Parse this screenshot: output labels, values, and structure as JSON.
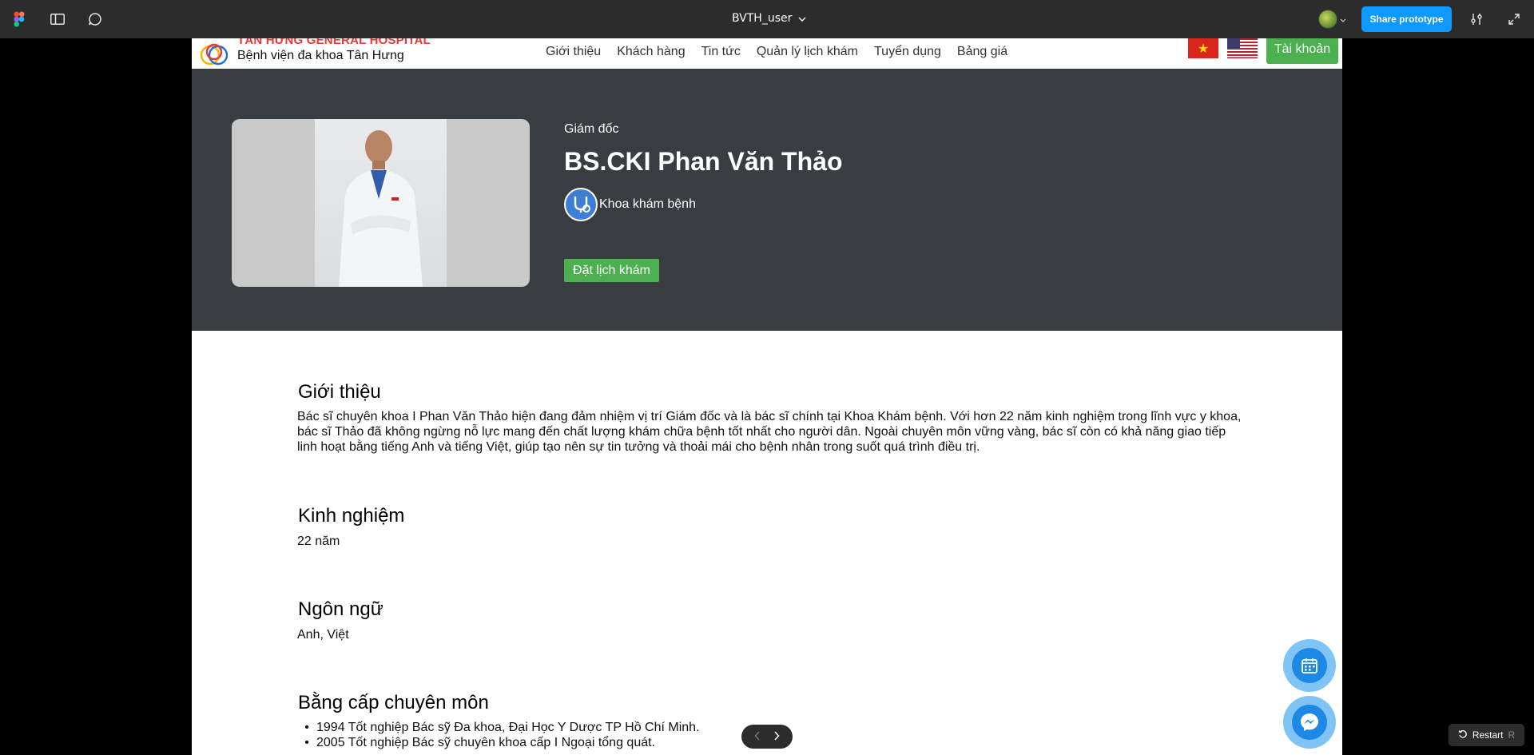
{
  "figma": {
    "file_title": "BVTH_user",
    "share_label": "Share prototype",
    "restart_label": "Restart",
    "restart_key": "R"
  },
  "site": {
    "logo_top": "TÂN HƯNG GENERAL HOSPITAL",
    "logo_bottom": "Bệnh viện đa khoa Tân Hưng",
    "nav": [
      "Giới thiệu",
      "Khách hàng",
      "Tin tức",
      "Quản lý lịch khám",
      "Tuyển dụng",
      "Bảng giá"
    ],
    "flag_vn_star": "★",
    "account_label": "Tài khoản"
  },
  "doctor": {
    "role": "Giám đốc",
    "name": "BS.CKI Phan Văn Thảo",
    "department": "Khoa khám bệnh",
    "book_label": "Đặt lịch khám"
  },
  "sections": {
    "intro_title": "Giới thiệu",
    "intro_body": "Bác sĩ chuyên khoa I Phan Văn Thảo hiện đang đảm nhiệm vị trí Giám đốc và là bác sĩ chính tại Khoa Khám bệnh. Với hơn 22 năm kinh nghiệm trong lĩnh vực y khoa, bác sĩ Thảo đã không ngừng nỗ lực mang đến chất lượng khám chữa bệnh tốt nhất cho người dân. Ngoài chuyên môn vững vàng, bác sĩ còn có khả năng giao tiếp linh hoạt bằng tiếng Anh và tiếng Việt, giúp tạo nên sự tin tưởng và thoải mái cho bệnh nhân trong suốt quá trình điều trị.",
    "experience_title": "Kinh nghiệm",
    "experience_value": "22 năm",
    "language_title": "Ngôn ngữ",
    "language_value": "Anh, Việt",
    "certs_title": "Bằng cấp chuyên môn",
    "certs": [
      "1994 Tốt nghiệp Bác sỹ Đa khoa, Đại Học Y Dược TP Hồ Chí Minh.",
      "2005 Tốt nghiệp Bác sỹ chuyên khoa cấp I Ngoại tổng quát."
    ]
  },
  "colors": {
    "figma_bar": "#2c2c2c",
    "share_blue": "#0d99ff",
    "hero_bg": "#393c41",
    "brand_green": "#4caf50",
    "logo_red": "#e53935"
  },
  "icons": {
    "figma_logo": "figma-logo-icon",
    "sidebar": "sidebar-toggle-icon",
    "comment": "comment-icon",
    "settings": "sliders-icon",
    "fullscreen": "expand-icon",
    "calendar": "calendar-icon",
    "messenger": "messenger-icon",
    "prev": "chevron-left-icon",
    "next": "chevron-right-icon"
  }
}
